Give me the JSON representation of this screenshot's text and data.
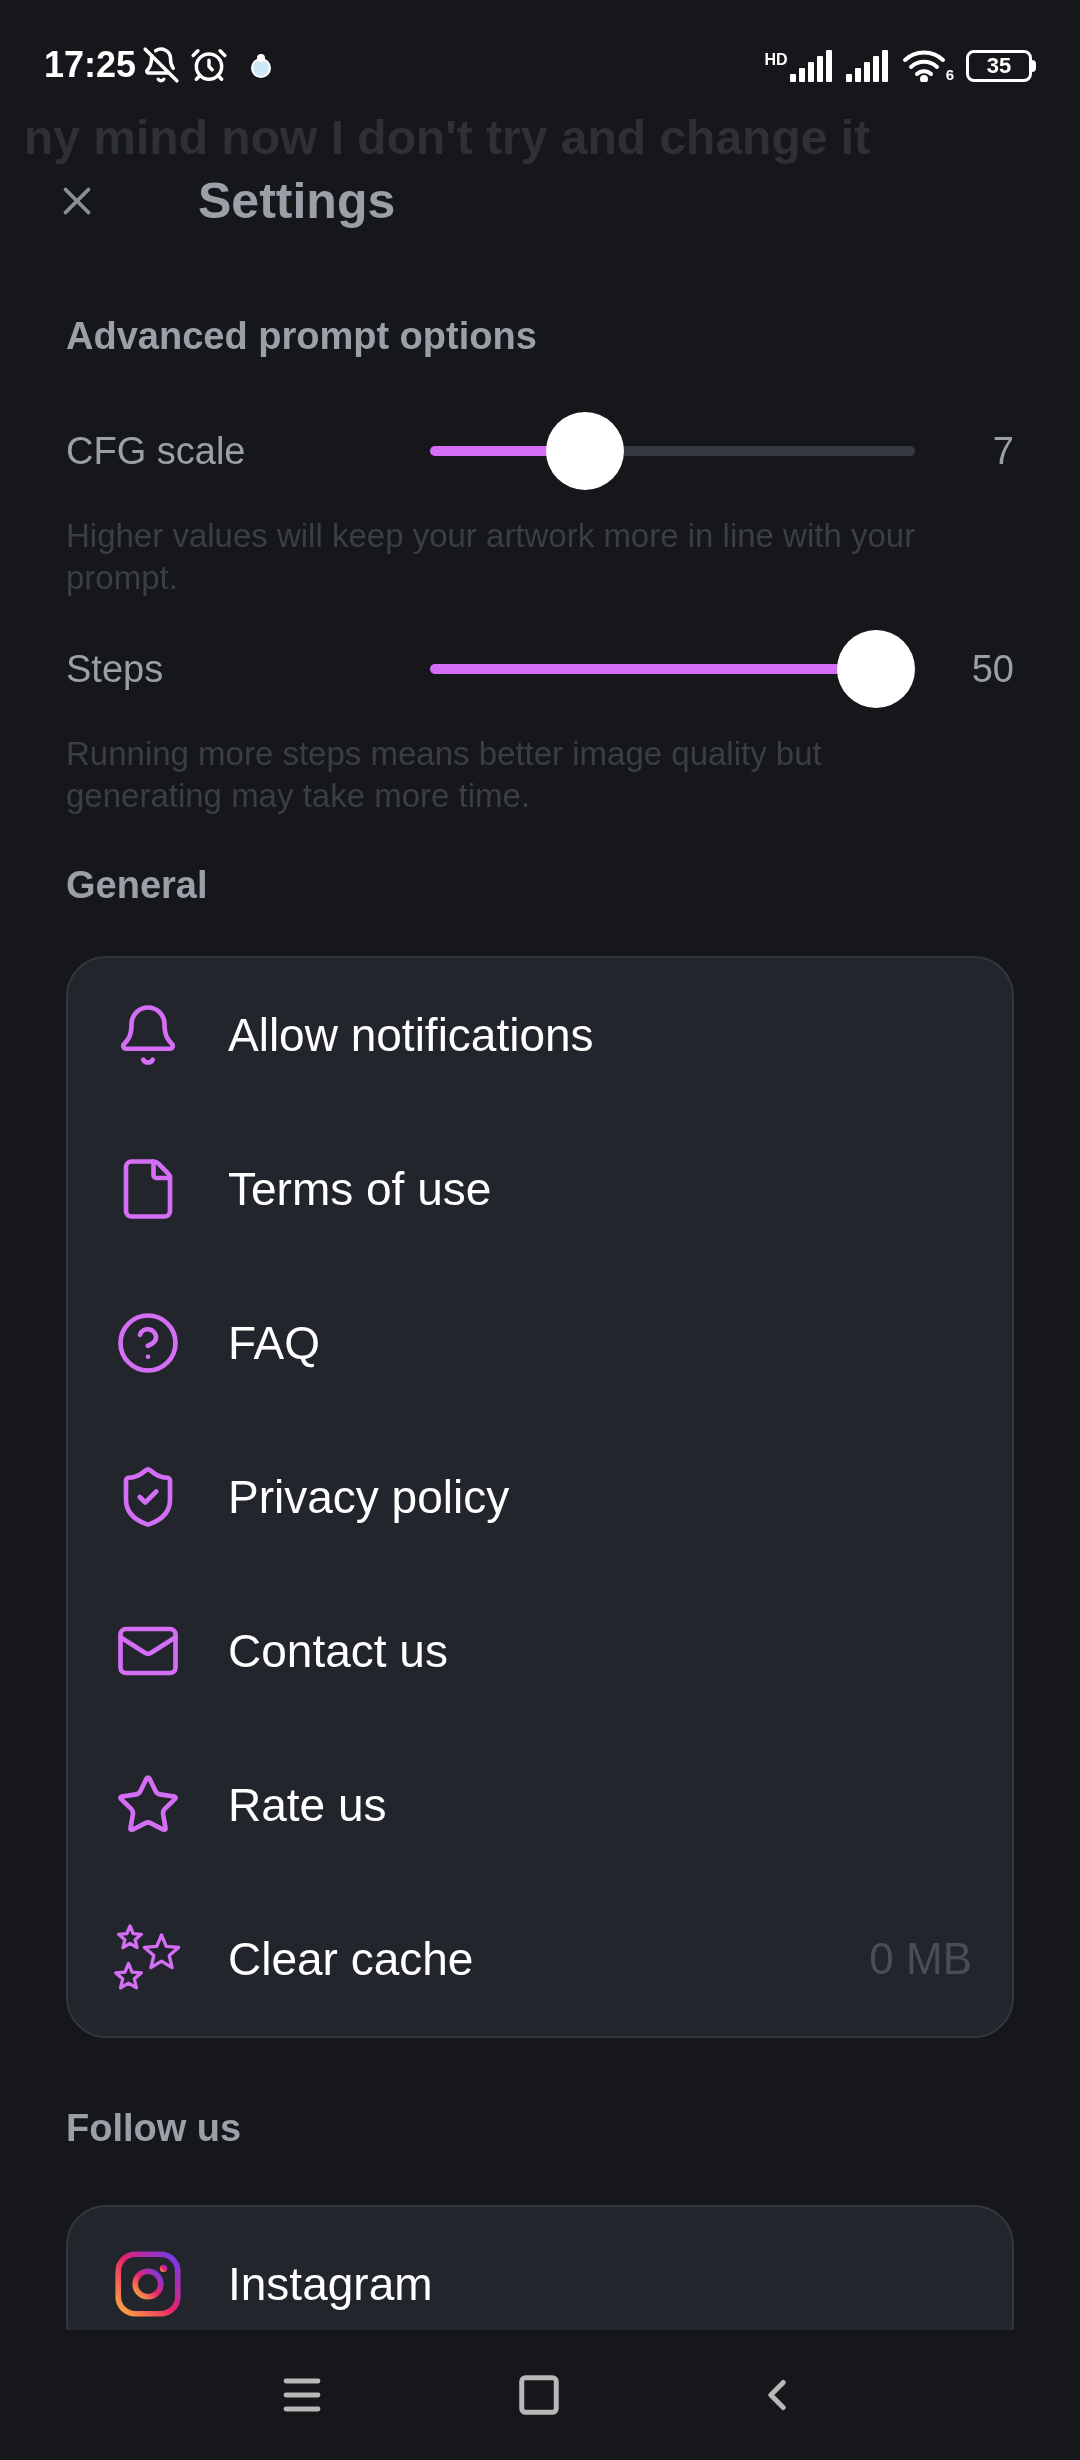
{
  "status_bar": {
    "time": "17:25",
    "battery": "35",
    "network": "HD",
    "wifi_badge": "6"
  },
  "ghost_text": "ny mind now I don't try and change it",
  "header": {
    "title": "Settings"
  },
  "advanced": {
    "title": "Advanced prompt options",
    "sliders": [
      {
        "label": "CFG scale",
        "level": 0.32,
        "reading": "7",
        "hint": "Higher values will keep your artwork more in line with your prompt."
      },
      {
        "label": "Steps",
        "level": 0.985,
        "reading": "50",
        "hint": "Running more steps means better image quality but generating may take more time."
      }
    ]
  },
  "general": {
    "title": "General",
    "items": [
      {
        "kind": "bell",
        "label": "Allow notifications"
      },
      {
        "kind": "document",
        "label": "Terms of use"
      },
      {
        "kind": "question",
        "label": "FAQ"
      },
      {
        "kind": "shield",
        "label": "Privacy policy"
      },
      {
        "kind": "mail",
        "label": "Contact us"
      },
      {
        "kind": "star",
        "label": "Rate us"
      },
      {
        "kind": "stars",
        "label": "Clear cache",
        "value": "0 MB"
      }
    ]
  },
  "follow": {
    "title": "Follow us",
    "items": [
      {
        "kind": "instagram",
        "label": "Instagram"
      }
    ]
  }
}
